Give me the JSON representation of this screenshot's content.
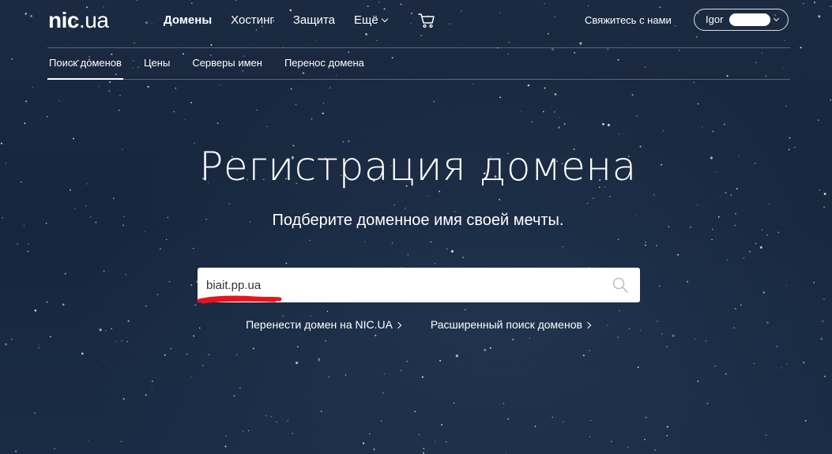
{
  "header": {
    "logo_main": "nic",
    "logo_ua": ".ua",
    "nav": [
      {
        "label": "Домены",
        "active": true
      },
      {
        "label": "Хостинг",
        "active": false
      },
      {
        "label": "Защита",
        "active": false
      },
      {
        "label": "Ещё",
        "active": false
      }
    ],
    "contact": "Свяжитесь с нами",
    "user_name": "Igor"
  },
  "subnav": [
    {
      "label": "Поиск доменов",
      "active": true
    },
    {
      "label": "Цены",
      "active": false
    },
    {
      "label": "Серверы имен",
      "active": false
    },
    {
      "label": "Перенос домена",
      "active": false
    }
  ],
  "hero": {
    "title": "Регистрация домена",
    "subtitle": "Подберите доменное имя своей мечты."
  },
  "search": {
    "value": "biait.pp.ua"
  },
  "links": {
    "transfer": "Перенести домен на NIC.UA",
    "advanced": "Расширенный поиск доменов"
  },
  "colors": {
    "background": "#16263c",
    "text": "#ffffff",
    "scribble": "#e8141c"
  },
  "icons": {
    "cart": "cart-icon",
    "search": "search-icon",
    "chevron": "chevron-down-icon"
  }
}
